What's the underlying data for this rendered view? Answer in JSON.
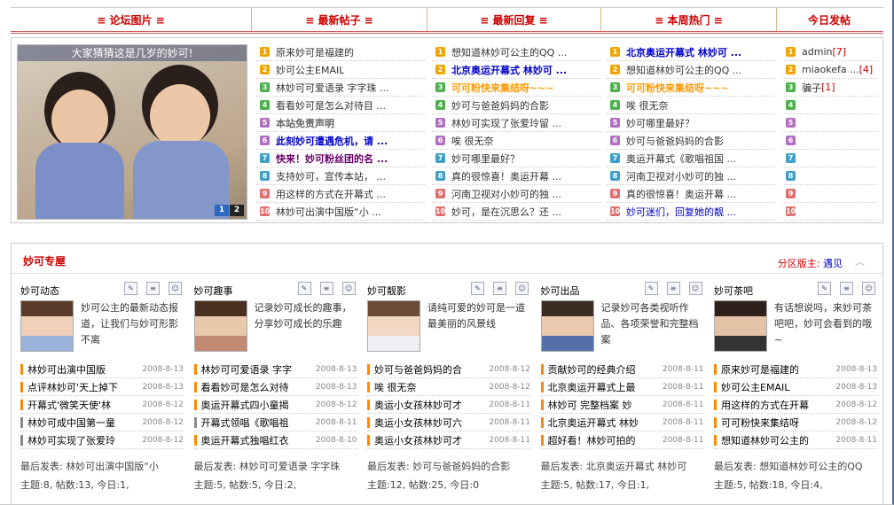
{
  "tabs": [
    "≡ 论坛图片 ≡",
    "≡ 最新帖子 ≡",
    "≡ 最新回复 ≡",
    "≡ 本周热门 ≡",
    "今日发帖"
  ],
  "photo": {
    "caption": "大家猜猜这是几岁的妙可!",
    "pages": [
      "1",
      "2"
    ]
  },
  "numColors": [
    "#f0a500",
    "#f0a500",
    "#4cb04c",
    "#4cb04c",
    "#b070c0",
    "#b070c0",
    "#40a0c8",
    "#40a0c8",
    "#e07070",
    "#e07070"
  ],
  "latest_posts": [
    {
      "n": "1",
      "t": "原来妙可是福建的",
      "s": ""
    },
    {
      "n": "2",
      "t": "妙可公主EMAIL",
      "s": ""
    },
    {
      "n": "3",
      "t": "林妙可可爱语录 字字珠 ...",
      "s": ""
    },
    {
      "n": "4",
      "t": "看看妙可是怎么对待目 ...",
      "s": ""
    },
    {
      "n": "5",
      "t": "本站免责声明",
      "s": "grey"
    },
    {
      "n": "6",
      "t": "此刻妙可遭遇危机，请 ...",
      "s": "hot"
    },
    {
      "n": "7",
      "t": "快来！妙可粉丝团的名 ...",
      "s": "purp"
    },
    {
      "n": "8",
      "t": "支持妙可，宣传本站， ...",
      "s": ""
    },
    {
      "n": "9",
      "t": "用这样的方式在开幕式 ...",
      "s": ""
    },
    {
      "n": "10",
      "t": "林妙可出演中国版“小 ...",
      "s": ""
    }
  ],
  "latest_replies": [
    {
      "n": "1",
      "t": "想知道林妙可公主的QQ ...",
      "s": ""
    },
    {
      "n": "2",
      "t": "北京奥运开幕式 林妙可 ...",
      "s": "hot"
    },
    {
      "n": "3",
      "t": "可可粉快来集结呀~~~",
      "s": "hot2"
    },
    {
      "n": "4",
      "t": "妙可与爸爸妈妈的合影",
      "s": ""
    },
    {
      "n": "5",
      "t": "林妙可实现了张爱玲留 ...",
      "s": ""
    },
    {
      "n": "6",
      "t": "唉 很无奈",
      "s": ""
    },
    {
      "n": "7",
      "t": "妙可哪里最好？",
      "s": ""
    },
    {
      "n": "8",
      "t": "真的很惊喜！奥运开幕 ...",
      "s": ""
    },
    {
      "n": "9",
      "t": "河南卫视对小妙可的独 ...",
      "s": ""
    },
    {
      "n": "10",
      "t": "妙可，是在沉思么？还 ...",
      "s": ""
    }
  ],
  "weekly_hot": [
    {
      "n": "1",
      "t": "北京奥运开幕式 林妙可 ...",
      "s": "hot"
    },
    {
      "n": "2",
      "t": "想知道林妙可公主的QQ ...",
      "s": ""
    },
    {
      "n": "3",
      "t": "可可粉快来集结呀~~~",
      "s": "hot2"
    },
    {
      "n": "4",
      "t": "唉 很无奈",
      "s": ""
    },
    {
      "n": "5",
      "t": "妙可哪里最好？",
      "s": ""
    },
    {
      "n": "6",
      "t": "妙可与爸爸妈妈的合影",
      "s": ""
    },
    {
      "n": "7",
      "t": "奥运开幕式《歌唱祖国 ...",
      "s": ""
    },
    {
      "n": "8",
      "t": "河南卫视对小妙可的独 ...",
      "s": ""
    },
    {
      "n": "9",
      "t": "真的很惊喜！奥运开幕 ...",
      "s": ""
    },
    {
      "n": "10",
      "t": "妙可迷们，回复她的靓 ...",
      "s": "blue"
    }
  ],
  "today_posters": [
    {
      "n": "1",
      "name": "admin",
      "count": "[7]"
    },
    {
      "n": "2",
      "name": "miaokefa ...",
      "count": "[4]"
    },
    {
      "n": "3",
      "name": "骗子",
      "count": "[1]"
    },
    {
      "n": "4",
      "name": "",
      "count": ""
    },
    {
      "n": "5",
      "name": "",
      "count": ""
    },
    {
      "n": "6",
      "name": "",
      "count": ""
    },
    {
      "n": "7",
      "name": "",
      "count": ""
    },
    {
      "n": "8",
      "name": "",
      "count": ""
    },
    {
      "n": "9",
      "name": "",
      "count": ""
    },
    {
      "n": "10",
      "name": "",
      "count": ""
    }
  ],
  "section": {
    "title": "妙可专屋",
    "moderator_label": "分区版主:",
    "moderator": "遇见",
    "collapse_icon": "chevron-up-icon"
  },
  "forums": [
    {
      "name": "妙可动态",
      "desc": "妙可公主的最新动态报道，让我们与妙可形影不离",
      "threads": [
        {
          "t": "林妙可出演中国版",
          "d": "2008-8-13",
          "m": "o"
        },
        {
          "t": "点评林妙可'天上掉下",
          "d": "2008-8-13",
          "m": "o"
        },
        {
          "t": "开幕式'微笑天使'林",
          "d": "2008-8-12",
          "m": "o"
        },
        {
          "t": "林妙可成中国第一童",
          "d": "2008-8-12",
          "m": "g"
        },
        {
          "t": "林妙可实现了张爱玲",
          "d": "2008-8-12",
          "m": "g"
        }
      ],
      "last": "最后发表: 林妙可出演中国版“小",
      "stats": "主题:8, 帖数:13, 今日:1,"
    },
    {
      "name": "妙可趣事",
      "desc": "记录妙可成长的趣事，分享妙可成长的乐趣",
      "threads": [
        {
          "t": "林妙可可爱语录 字字",
          "d": "2008-8-13",
          "m": "o"
        },
        {
          "t": "看看妙可是怎么对待",
          "d": "2008-8-13",
          "m": "o"
        },
        {
          "t": "奥运开幕式四小童揭",
          "d": "2008-8-12",
          "m": "o"
        },
        {
          "t": "开幕式领唱《歌唱祖",
          "d": "2008-8-11",
          "m": "g"
        },
        {
          "t": "奥运开幕式独唱红衣",
          "d": "2008-8-10",
          "m": "o"
        }
      ],
      "last": "最后发表: 林妙可可爱语录 字字珠",
      "stats": "主题:5, 帖数:5, 今日:2,"
    },
    {
      "name": "妙可靓影",
      "desc": "请纯可爱的妙可是一道最美丽的风景线",
      "threads": [
        {
          "t": "妙可与爸爸妈妈的合",
          "d": "2008-8-12",
          "m": "o"
        },
        {
          "t": "唉 很无奈",
          "d": "2008-8-12",
          "m": "o"
        },
        {
          "t": "奥运小女孩林妙可才",
          "d": "2008-8-11",
          "m": "o"
        },
        {
          "t": "奥运小女孩林妙可六",
          "d": "2008-8-11",
          "m": "o"
        },
        {
          "t": "奥运小女孩林妙可才",
          "d": "2008-8-11",
          "m": "o"
        }
      ],
      "last": "最后发表: 妙可与爸爸妈妈的合影",
      "stats": "主题:12, 帖数:25, 今日:0"
    },
    {
      "name": "妙可出品",
      "desc": "记录妙可各类视听作品、各项荣誉和完整档案",
      "threads": [
        {
          "t": "贡献妙可的经典介绍",
          "d": "2008-8-11",
          "m": "o"
        },
        {
          "t": "北京奥运开幕式上最",
          "d": "2008-8-11",
          "m": "o"
        },
        {
          "t": "林妙可 完整档案 妙",
          "d": "2008-8-11",
          "m": "o"
        },
        {
          "t": "北京奥运开幕式 林妙",
          "d": "2008-8-11",
          "m": "o"
        },
        {
          "t": "超好看！林妙可拍的",
          "d": "2008-8-11",
          "m": "o"
        }
      ],
      "last": "最后发表: 北京奥运开幕式 林妙可",
      "stats": "主题:5, 帖数:17, 今日:1,"
    },
    {
      "name": "妙可茶吧",
      "desc": "有话想说吗，来妙可茶吧吧，妙可会看到的哦~",
      "threads": [
        {
          "t": "原来妙可是福建的",
          "d": "2008-8-13",
          "m": "o"
        },
        {
          "t": "妙可公主EMAIL",
          "d": "2008-8-13",
          "m": "o"
        },
        {
          "t": "用这样的方式在开幕",
          "d": "2008-8-12",
          "m": "o"
        },
        {
          "t": "可可粉快来集结呀",
          "d": "2008-8-12",
          "m": "o"
        },
        {
          "t": "想知道林妙可公主的",
          "d": "2008-8-11",
          "m": "o"
        }
      ],
      "last": "最后发表: 想知道林妙可公主的QQ",
      "stats": "主题:5, 帖数:18, 今日:4,"
    }
  ]
}
